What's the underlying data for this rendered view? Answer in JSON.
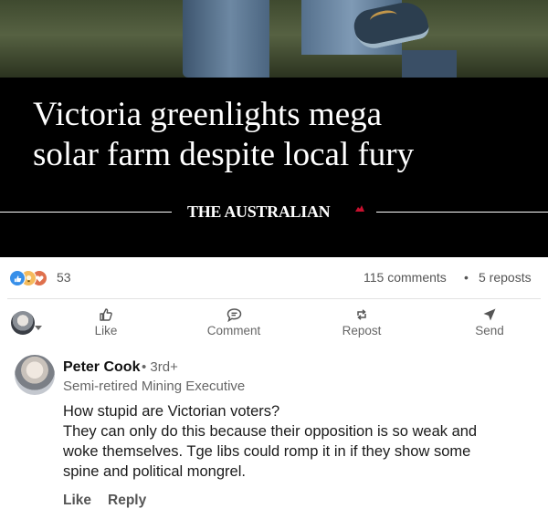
{
  "article": {
    "headline_line1": "Victoria greenlights mega",
    "headline_line2": "solar farm despite local fury",
    "publication": "THE AUSTRALIAN"
  },
  "stats": {
    "reaction_icons": [
      "like-icon",
      "insightful-icon",
      "love-icon"
    ],
    "reactions": "53",
    "comments": "115 comments",
    "separator": "•",
    "reposts": "5 reposts"
  },
  "actions": {
    "like": "Like",
    "comment": "Comment",
    "repost": "Repost",
    "send": "Send"
  },
  "comment": {
    "author": "Peter Cook",
    "degree": "• 3rd+",
    "headline": "Semi-retired Mining Executive",
    "text_line1": "How stupid are Victorian voters?",
    "text_line2": "They can only do this because their opposition is so weak and",
    "text_line3": "woke themselves.  Tge libs could romp it in if they show some",
    "text_line4": "spine and political mongrel.",
    "like": "Like",
    "reply": "Reply"
  },
  "colors": {
    "like_blue": "#378fe9",
    "insightful_yellow": "#f5bb5c",
    "love_red": "#df704d",
    "masthead_accent": "#c8102e"
  }
}
